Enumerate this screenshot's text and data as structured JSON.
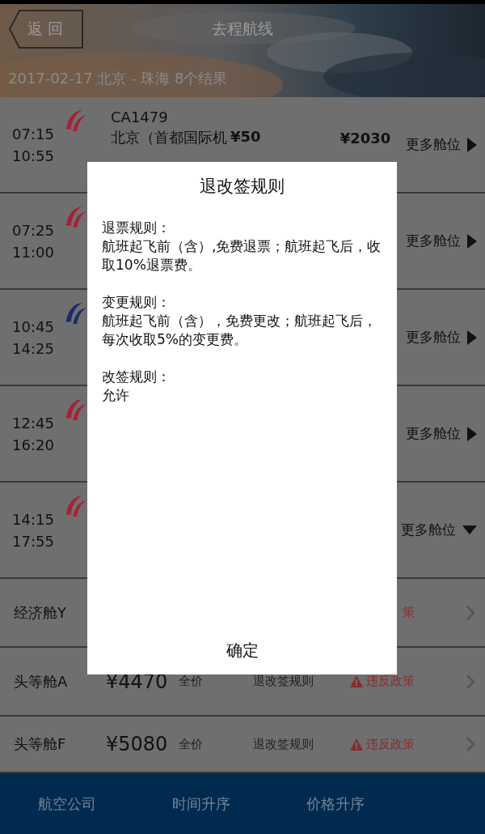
{
  "header": {
    "back": "返 回",
    "title": "去程航线",
    "summary": "2017-02-17  北京 - 珠海  8个结果"
  },
  "flights": [
    {
      "depart": "07:15",
      "arrive": "10:55",
      "color": "#a8203a",
      "number": "CA1479",
      "route": "北京（首都国际机",
      "price_low": "¥50",
      "price": "¥2030",
      "more": "更多舱位",
      "expanded": false
    },
    {
      "depart": "07:25",
      "arrive": "11:00",
      "color": "#a8203a",
      "more": "更多舱位",
      "expanded": false
    },
    {
      "depart": "10:45",
      "arrive": "14:25",
      "color": "#1c2a6a",
      "more": "更多舱位",
      "expanded": false
    },
    {
      "depart": "12:45",
      "arrive": "16:20",
      "color": "#a8203a",
      "more": "更多舱位",
      "expanded": false
    },
    {
      "depart": "14:15",
      "arrive": "17:55",
      "color": "#a8203a",
      "more": "更多舱位",
      "expanded": true
    }
  ],
  "cabins": [
    {
      "name": "经济舱Y",
      "policy": "策"
    },
    {
      "name": "头等舱A",
      "price": "¥4470",
      "fare": "全价",
      "rules": "退改签规则",
      "policy": "违反政策"
    },
    {
      "name": "头等舱F",
      "price": "¥5080",
      "fare": "全价",
      "rules": "退改签规则",
      "policy": "违反政策"
    }
  ],
  "dialog": {
    "title": "退改签规则",
    "sections": [
      {
        "heading": "退票规则：",
        "text": "航班起飞前（含）,免费退票；航班起飞后，收取10%退票费。"
      },
      {
        "heading": "变更规则：",
        "text": "航班起飞前（含），免费更改；航班起飞后，每次收取5%的变更费。"
      },
      {
        "heading": "改签规则：",
        "text": "允许"
      }
    ],
    "confirm": "确定"
  },
  "bottom_tabs": [
    "航空公司",
    "时间升序",
    "价格升序"
  ]
}
